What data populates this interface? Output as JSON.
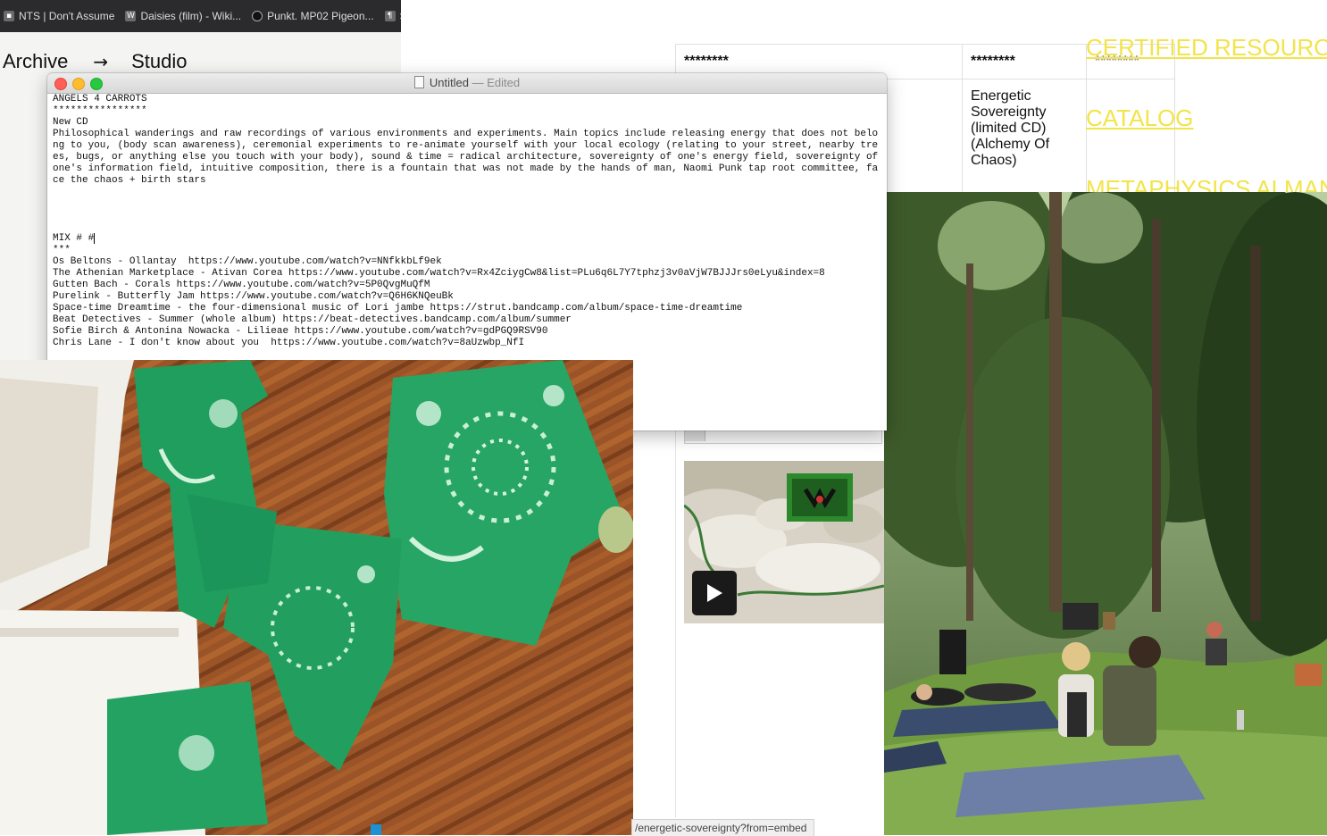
{
  "browser": {
    "tabs": [
      {
        "icon": "nts-icon",
        "label": "NTS | Don't Assume"
      },
      {
        "icon": "wikipedia-icon",
        "label": "Daisies (film) - Wiki..."
      },
      {
        "icon": "circle-icon",
        "label": "Punkt. MP02 Pigeon..."
      },
      {
        "icon": "site-icon",
        "label": "S"
      }
    ],
    "nav": {
      "archive": "Archive",
      "arrow": "→",
      "studio": "Studio"
    }
  },
  "catalog": {
    "header": [
      "********",
      "********",
      "********"
    ],
    "row1_item": "Energetic Sovereignty (limited CD) (Alchemy Of Chaos)",
    "nav_links": [
      "CERTIFIED RESOURCE",
      "CATALOG",
      "METAPHYSICS ALMAN"
    ],
    "colors": {
      "link": "#f2e44a"
    }
  },
  "status_url": "/energetic-sovereignty?from=embed",
  "textedit": {
    "title": "Untitled",
    "edited": "— Edited",
    "heading": "ANGELS 4 CARROTS",
    "stars_line": "****************",
    "subheading": "New CD",
    "description": "Philosophical wanderings and raw recordings of various environments and experiments. Main topics include releasing energy that does not belong to you, (body scan awareness), ceremonial experiments to re-animate yourself with your local ecology (relating to your street, nearby trees, bugs, or anything else you touch with your body), sound & time = radical architecture, sovereignty of one's energy field, sovereignty of one's information field, intuitive composition, there is a fountain that was not made by the hands of man, Naomi Punk tap root committee, face the chaos + birth stars",
    "mix_heading": "MIX # #",
    "mix_stars": "***",
    "tracks": [
      "Os Beltons - Ollantay  https://www.youtube.com/watch?v=NNfkkbLf9ek",
      "The Athenian Marketplace - Ativan Corea https://www.youtube.com/watch?v=Rx4ZciygCw8&list=PLu6q6L7Y7tphzj3v0aVjW7BJJJrs0eLyu&index=8",
      "Gutten Bach - Corals https://www.youtube.com/watch?v=5P0QvgMuQfM",
      "Purelink - Butterfly Jam https://www.youtube.com/watch?v=Q6H6KNQeuBk",
      "Space-time Dreamtime - the four-dimensional music of Lori jambe https://strut.bandcamp.com/album/space-time-dreamtime",
      "Beat Detectives - Summer (whole album) https://beat-detectives.bandcamp.com/album/summer",
      "Sofie Birch & Antonina Nowacka - Lilieae https://www.youtube.com/watch?v=gdPGQ9RSV90",
      "Chris Lane - I don't know about you  https://www.youtube.com/watch?v=8aUzwbp_NfI"
    ]
  }
}
